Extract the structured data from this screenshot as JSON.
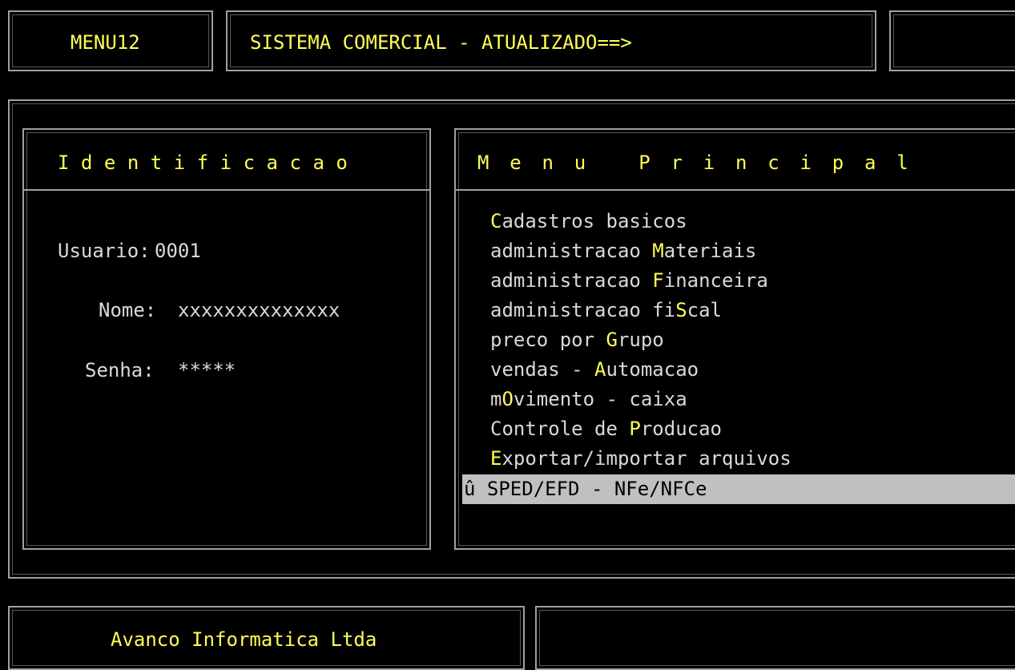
{
  "header": {
    "program_code": "MENU12",
    "title": "SISTEMA COMERCIAL - ATUALIZADO==>",
    "right_panel_text": ""
  },
  "identificacao": {
    "title": "Identificacao",
    "usuario_label": "Usuario:",
    "usuario_value": "0001",
    "nome_label": "Nome:",
    "nome_value": "xxxxxxxxxxxxxx",
    "senha_label": "Senha:",
    "senha_value": "*****"
  },
  "menu": {
    "title": "Menu Principal",
    "items": [
      {
        "pre": "",
        "hotkey": "C",
        "post": "adastros basicos"
      },
      {
        "pre": "administracao ",
        "hotkey": "M",
        "post": "ateriais"
      },
      {
        "pre": "administracao ",
        "hotkey": "F",
        "post": "inanceira"
      },
      {
        "pre": "administracao fi",
        "hotkey": "S",
        "post": "cal"
      },
      {
        "pre": "preco por ",
        "hotkey": "G",
        "post": "rupo"
      },
      {
        "pre": "vendas - ",
        "hotkey": "A",
        "post": "utomacao"
      },
      {
        "pre": "m",
        "hotkey": "O",
        "post": "vimento - caixa"
      },
      {
        "pre": "Controle de ",
        "hotkey": "P",
        "post": "roducao"
      },
      {
        "pre": "",
        "hotkey": "E",
        "post": "xportar/importar arquivos"
      }
    ],
    "selected_marker": "û",
    "selected_label": "SPED/EFD - NFe/NFCe"
  },
  "footer": {
    "company": "Avanco Informatica Ltda",
    "right_panel_text": ""
  },
  "colors": {
    "background": "#000000",
    "highlight_text": "#ffff55",
    "normal_text": "#d9d9d9",
    "selection_bar": "#c0c0c0",
    "border": "#a0a0a0"
  }
}
